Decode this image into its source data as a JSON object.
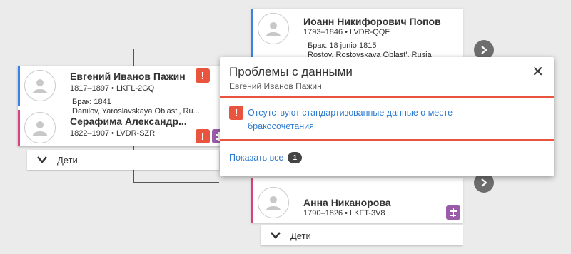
{
  "left_couple": {
    "husband": {
      "name": "Евгений Иванов Пажин",
      "lifespan_id": "1817–1897 • LKFL-2GQ",
      "marriage_line1": "Брак: 1841",
      "marriage_line2": "Danilov, Yaroslavskaya Oblast', Ru..."
    },
    "wife": {
      "name": "Серафима Александр...",
      "lifespan_id": "1822–1907 • LVDR-SZR"
    },
    "children_label": "Дети"
  },
  "top_right_couple": {
    "husband": {
      "name": "Иоанн Никифорович Попов",
      "lifespan_id": "1793–1846 • LVDR-QQF",
      "marriage_line1": "Брак: 18 junio 1815",
      "marriage_line2": "Rostov, Rostovskaya Oblast', Rusia"
    }
  },
  "bottom_right_couple": {
    "wife": {
      "name": "Анна Никанорова",
      "lifespan_id": "1790–1826 • LKFT-3V8"
    },
    "children_label": "Дети"
  },
  "popup": {
    "title": "Проблемы с данными",
    "subtitle": "Евгений Иванов Пажин",
    "issue": "Отсутствуют стандартизованные данные о месте бракосочетания",
    "show_all_label": "Показать все",
    "show_all_count": "1",
    "close_glyph": "✕",
    "badge_glyph": "!"
  },
  "colors": {
    "male": "#3a82e4",
    "female": "#d9437c",
    "alert": "#e8543d",
    "record_hint": "#9a5ba8",
    "link": "#2e7bcf"
  }
}
